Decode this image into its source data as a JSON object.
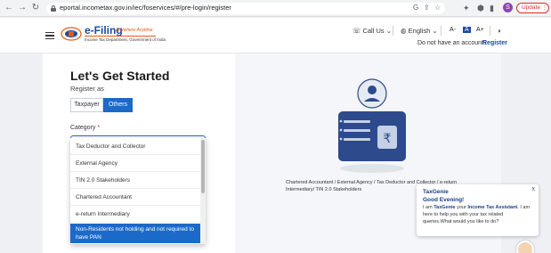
{
  "browser": {
    "url": "eportal.incometax.gov.in/iec/foservices/#/pre-login/register",
    "profile_initial": "S",
    "update_label": "Update"
  },
  "header": {
    "logo_title": "e-Filing",
    "logo_tagline": "Anywhere Anytime",
    "logo_subtitle": "Income Tax Department, Government of India",
    "call_us": "Call Us",
    "language": "English",
    "font_decrease": "A-",
    "font_normal": "A",
    "font_increase": "A+",
    "no_account_text": "Do not have an account?",
    "register_link": "Register"
  },
  "form": {
    "title": "Let's Get Started",
    "register_as": "Register as",
    "taxpayer": "Taxpayer",
    "others": "Others",
    "category_label": "Category",
    "required_mark": "*",
    "options": [
      "Tax Deductor and Collector",
      "External Agency",
      "TIN 2.0 Stakeholders",
      "Chartered Accountant",
      "e-return Intermediary",
      "Non-Residents not holding and not required to have PAN"
    ],
    "highlighted_index": 5
  },
  "illustration": {
    "caption": "Chartered Accountant / External Agency / Tax Deductor and Collector / e-return Intermediary/ TIN 2.0 Stakeholders",
    "symbol": "₹"
  },
  "chat": {
    "name": "TaxGenie",
    "greeting": "Good Evening!",
    "body_1": "I am ",
    "body_bold_1": "TaxGenie",
    "body_2": " your ",
    "body_bold_2": "Income Tax Assistant",
    "body_3": ". I am here to help you with your tax related queries.What would you like to do?",
    "close": "x"
  },
  "colors": {
    "primary": "#1b6ac9",
    "brand_blue": "#1b4aa3",
    "accent_orange": "#e25b14"
  }
}
